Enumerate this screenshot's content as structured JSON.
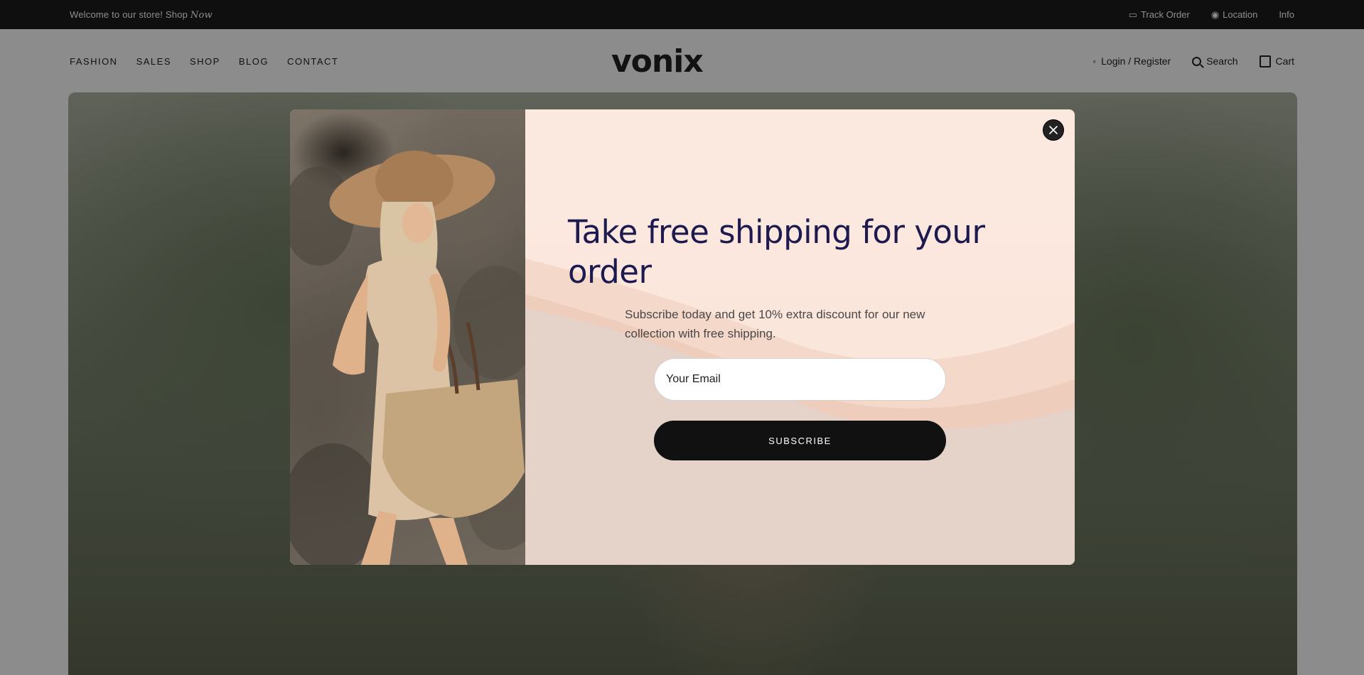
{
  "topbar": {
    "promo": "Welcome to our store! Shop",
    "promo_em": "Now",
    "track": "Track Order",
    "location": "Location",
    "info": "Info"
  },
  "header": {
    "logo": "vonix",
    "nav": [
      "FASHION",
      "SALES",
      "SHOP",
      "BLOG",
      "CONTACT"
    ],
    "login": "Login / Register",
    "search": "Search",
    "cart": "Cart"
  },
  "popup": {
    "title": "Take free shipping for your order",
    "subtitle": "Subscribe today and get 10% extra discount for our new collection with free shipping.",
    "email_placeholder": "Your Email",
    "button": "SUBSCRIBE",
    "close_icon": "close-icon"
  },
  "colors": {
    "title": "#1c1a4e",
    "button": "#111111",
    "popup_bg": "#fbe8df",
    "wave": "#f4d0c2"
  }
}
